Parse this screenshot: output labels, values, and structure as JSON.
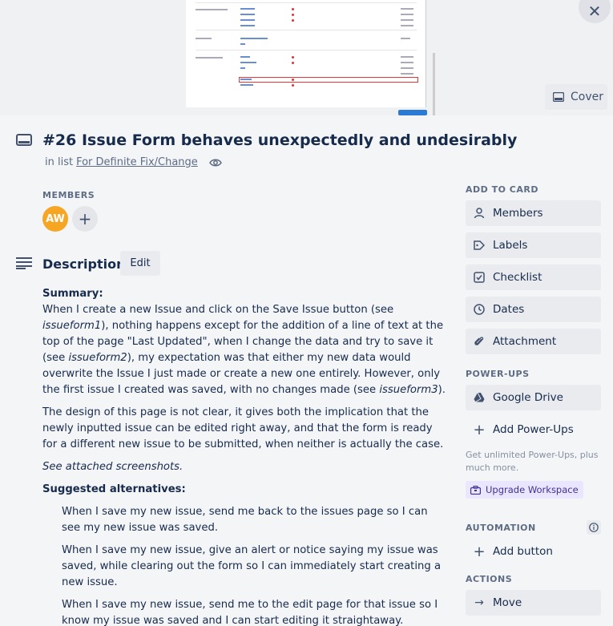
{
  "cover": {
    "button_label": "Cover"
  },
  "card": {
    "title": "#26 Issue Form behaves unexpectedly and undesirably",
    "in_list_prefix": "in list",
    "list_name": "For Definite Fix/Change"
  },
  "members": {
    "label": "MEMBERS",
    "avatar_initials": "AW"
  },
  "description": {
    "title": "Description",
    "edit_label": "Edit",
    "summary_label": "Summary:",
    "p1_a": "When I create a new Issue and click on the Save Issue button (see ",
    "p1_i1": "issueform1",
    "p1_b": "), nothing happens except for the addition of a line of text at the top of the page \"Last Updated\", when I change the data and try to save it (see ",
    "p1_i2": "issueform2",
    "p1_c": "), my expectation was that either my new data would overwrite the Issue I just made or create a new one entirely. However, only the first issue I created was saved, with no changes made (see ",
    "p1_i3": "issueform3",
    "p1_d": ").",
    "p2": "The design of this page is not clear, it gives both the implication that the newly inputted issue can be edited right away, and that the form is ready for a different new issue to be submitted, when neither is actually the case.",
    "p3": "See attached screenshots.",
    "alternatives_label": "Suggested alternatives:",
    "alternatives": [
      "When I save my new issue, send me back to the issues page so I can see my new issue was saved.",
      "When I save my new issue, give an alert or notice saying my issue was saved, while clearing out the form so I can immediately start creating a new issue.",
      "When I save my new issue, send me to the edit page for that issue so I know my issue was saved and I can start editing it straightaway."
    ]
  },
  "sidebar": {
    "add_to_card_label": "ADD TO CARD",
    "add_to_card": [
      "Members",
      "Labels",
      "Checklist",
      "Dates",
      "Attachment"
    ],
    "powerups_label": "POWER-UPS",
    "google_drive": "Google Drive",
    "add_powerups": "Add Power-Ups",
    "promo": "Get unlimited Power-Ups, plus much more.",
    "upgrade": "Upgrade Workspace",
    "automation_label": "AUTOMATION",
    "add_button": "Add button",
    "actions_label": "ACTIONS",
    "move": "Move"
  },
  "colors": {
    "avatar": "#f6a623",
    "upgrade_bg": "#eae6ff",
    "title_text": "#172b4d"
  }
}
